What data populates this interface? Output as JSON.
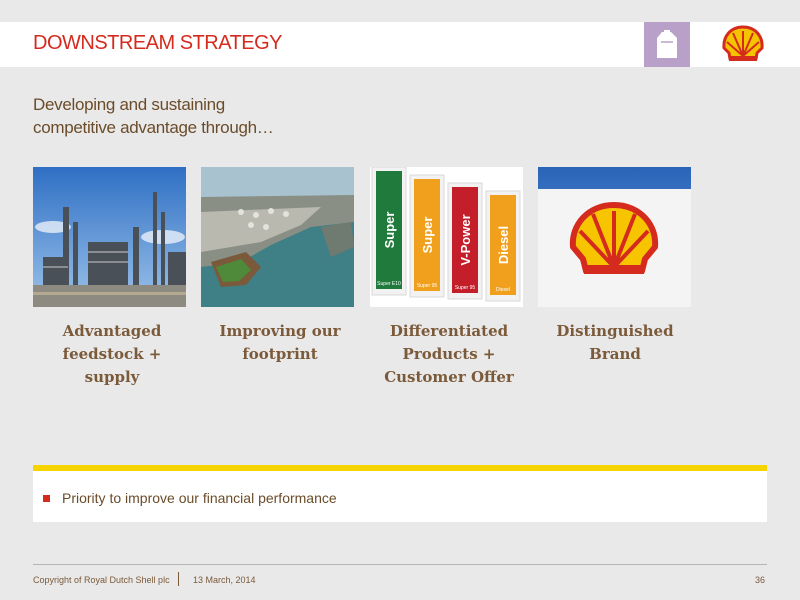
{
  "header": {
    "title": "DOWNSTREAM STRATEGY",
    "category_icon": "fuel-can-icon",
    "logo_icon": "shell-pecten-icon"
  },
  "subtitle": {
    "line1": "Developing and sustaining",
    "line2": "competitive advantage through…"
  },
  "pillars": [
    {
      "image": "refinery-photo",
      "lines": [
        "Advantaged",
        "feedstock +",
        "supply"
      ]
    },
    {
      "image": "coastal-refinery-aerial-photo",
      "lines": [
        "Improving our",
        "footprint"
      ]
    },
    {
      "image": "fuel-pump-labels-photo",
      "lines": [
        "Differentiated",
        "Products +",
        "Customer Offer"
      ]
    },
    {
      "image": "shell-logo-sign-photo",
      "lines": [
        "Distinguished",
        "Brand"
      ]
    }
  ],
  "pump_labels": [
    {
      "text": "Super",
      "small": "Super E10",
      "color": "#1f7a3c"
    },
    {
      "text": "Super",
      "small": "Super 95",
      "color": "#f0a01c"
    },
    {
      "text": "V-Power",
      "small": "Super 95",
      "color": "#c41e2a"
    },
    {
      "text": "Diesel",
      "small": "Diesel",
      "color": "#f0a01c"
    }
  ],
  "priority": {
    "text": "Priority to improve our financial performance"
  },
  "footer": {
    "copyright": "Copyright of Royal Dutch Shell plc",
    "date": "13 March, 2014",
    "page": "36"
  },
  "colors": {
    "shell_red": "#d52b1e",
    "shell_yellow": "#f5d400",
    "brown_text": "#6b4c2a",
    "category_purple": "#b9a0c9"
  }
}
